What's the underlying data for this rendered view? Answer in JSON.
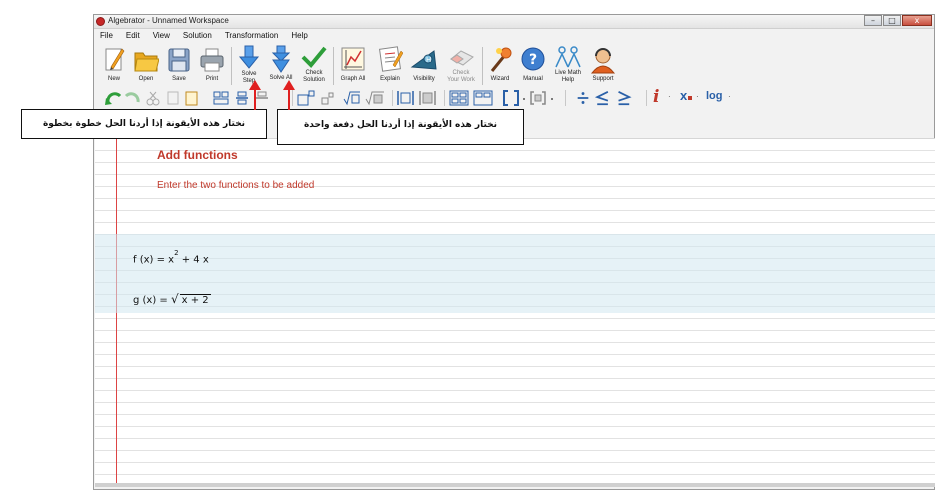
{
  "window": {
    "title": "Algebrator - Unnamed Workspace",
    "controls": [
      "–",
      "□",
      "x"
    ]
  },
  "menu": [
    "File",
    "Edit",
    "View",
    "Solution",
    "Transformation",
    "Help"
  ],
  "toolbar": {
    "new": "New",
    "open": "Open",
    "save": "Save",
    "print": "Print",
    "solve_step_1": "Solve",
    "solve_step_2": "Step",
    "solve_all": "Solve All",
    "check_solution_1": "Check",
    "check_solution_2": "Solution",
    "graph_all": "Graph All",
    "explain": "Explain",
    "visibility": "Visibility",
    "check_work_1": "Check",
    "check_work_2": "Your Work",
    "wizard": "Wizard",
    "manual": "Manual",
    "live_help_1": "Live Math",
    "live_help_2": "Help",
    "support": "Support"
  },
  "toolbar2": {
    "imaginary": "i",
    "subscript": "x",
    "log": "log"
  },
  "workspace": {
    "heading": "Add functions",
    "instruction": "Enter the two functions to be added",
    "f_lhs": "f (x) = x",
    "f_exp": "2",
    "f_rest": "+ 4 x",
    "g_lhs": "g (x) =",
    "g_radicand": "x + 2"
  },
  "annotations": {
    "step": "نختار هذه الأيقونة إذا أردنا الحل خطوة بخطوة",
    "all": "نختار هذه الأيقونة إذا أردنا الحل دفعة واحدة"
  },
  "colors": {
    "accent_red": "#c0392b",
    "arrow_red": "#e02020",
    "solve_blue": "#3f8fe0",
    "check_green": "#2e9e3a"
  }
}
